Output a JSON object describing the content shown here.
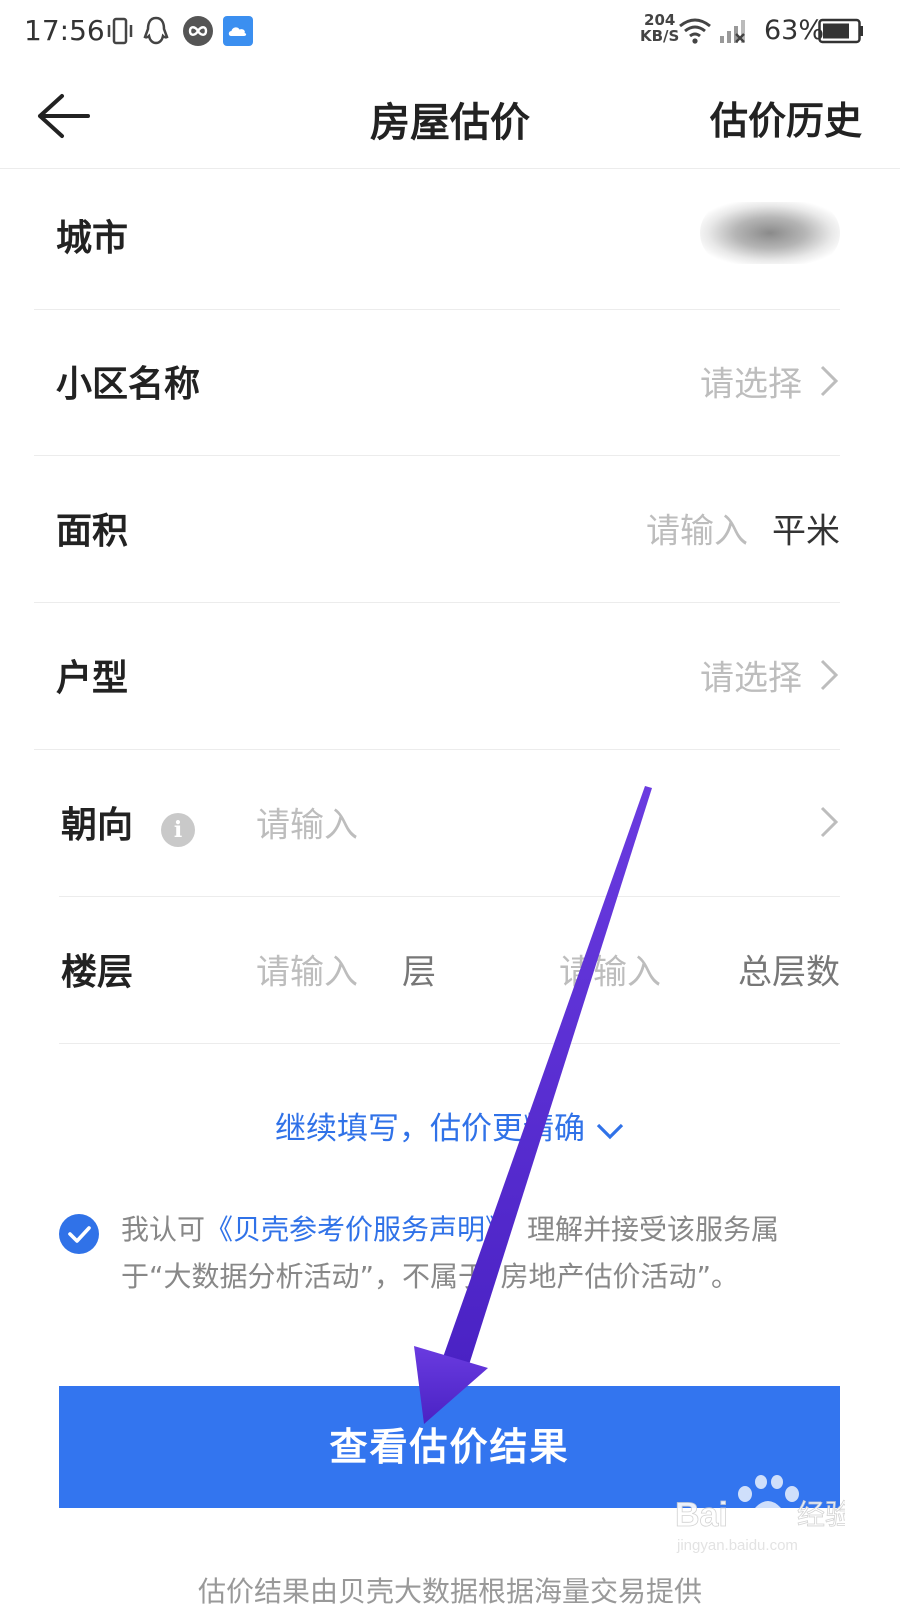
{
  "status_bar": {
    "time": "17:56",
    "net_speed_value": "204",
    "net_speed_unit": "KB/S",
    "battery": "63%",
    "icons": [
      "vibrate-icon",
      "qq-icon",
      "infinity-app-icon",
      "cloud-app-icon",
      "wifi-icon",
      "signal-icon",
      "battery-icon"
    ]
  },
  "header": {
    "title": "房屋估价",
    "history": "估价历史"
  },
  "form": {
    "city_label": "城市",
    "community_label": "小区名称",
    "community_placeholder": "请选择",
    "area_label": "面积",
    "area_placeholder": "请输入",
    "area_unit": "平米",
    "layout_label": "户型",
    "layout_placeholder": "请选择",
    "orientation_label": "朝向",
    "orientation_placeholder": "请输入",
    "floor_label": "楼层",
    "floor_placeholder": "请输入",
    "floor_unit": "层",
    "total_floor_placeholder": "请输入",
    "total_floor_unit": "总层数"
  },
  "more_link": "继续填写，估价更精确",
  "agreement": {
    "prefix": "我认可",
    "link": "《贝壳参考价服务声明》",
    "suffix": "，理解并接受该服务属于“大数据分析活动”，不属于“房地产估价活动”。",
    "checked": true
  },
  "submit_label": "查看估价结果",
  "footer_note": "估价结果由贝壳大数据根据海量交易提供",
  "watermark": "Baidu经验 jingyan.baidu.com",
  "colors": {
    "accent": "#3375ef",
    "link": "#3072e8",
    "placeholder": "#bdbdbd",
    "annotation_arrow": "#5a2fd0"
  }
}
